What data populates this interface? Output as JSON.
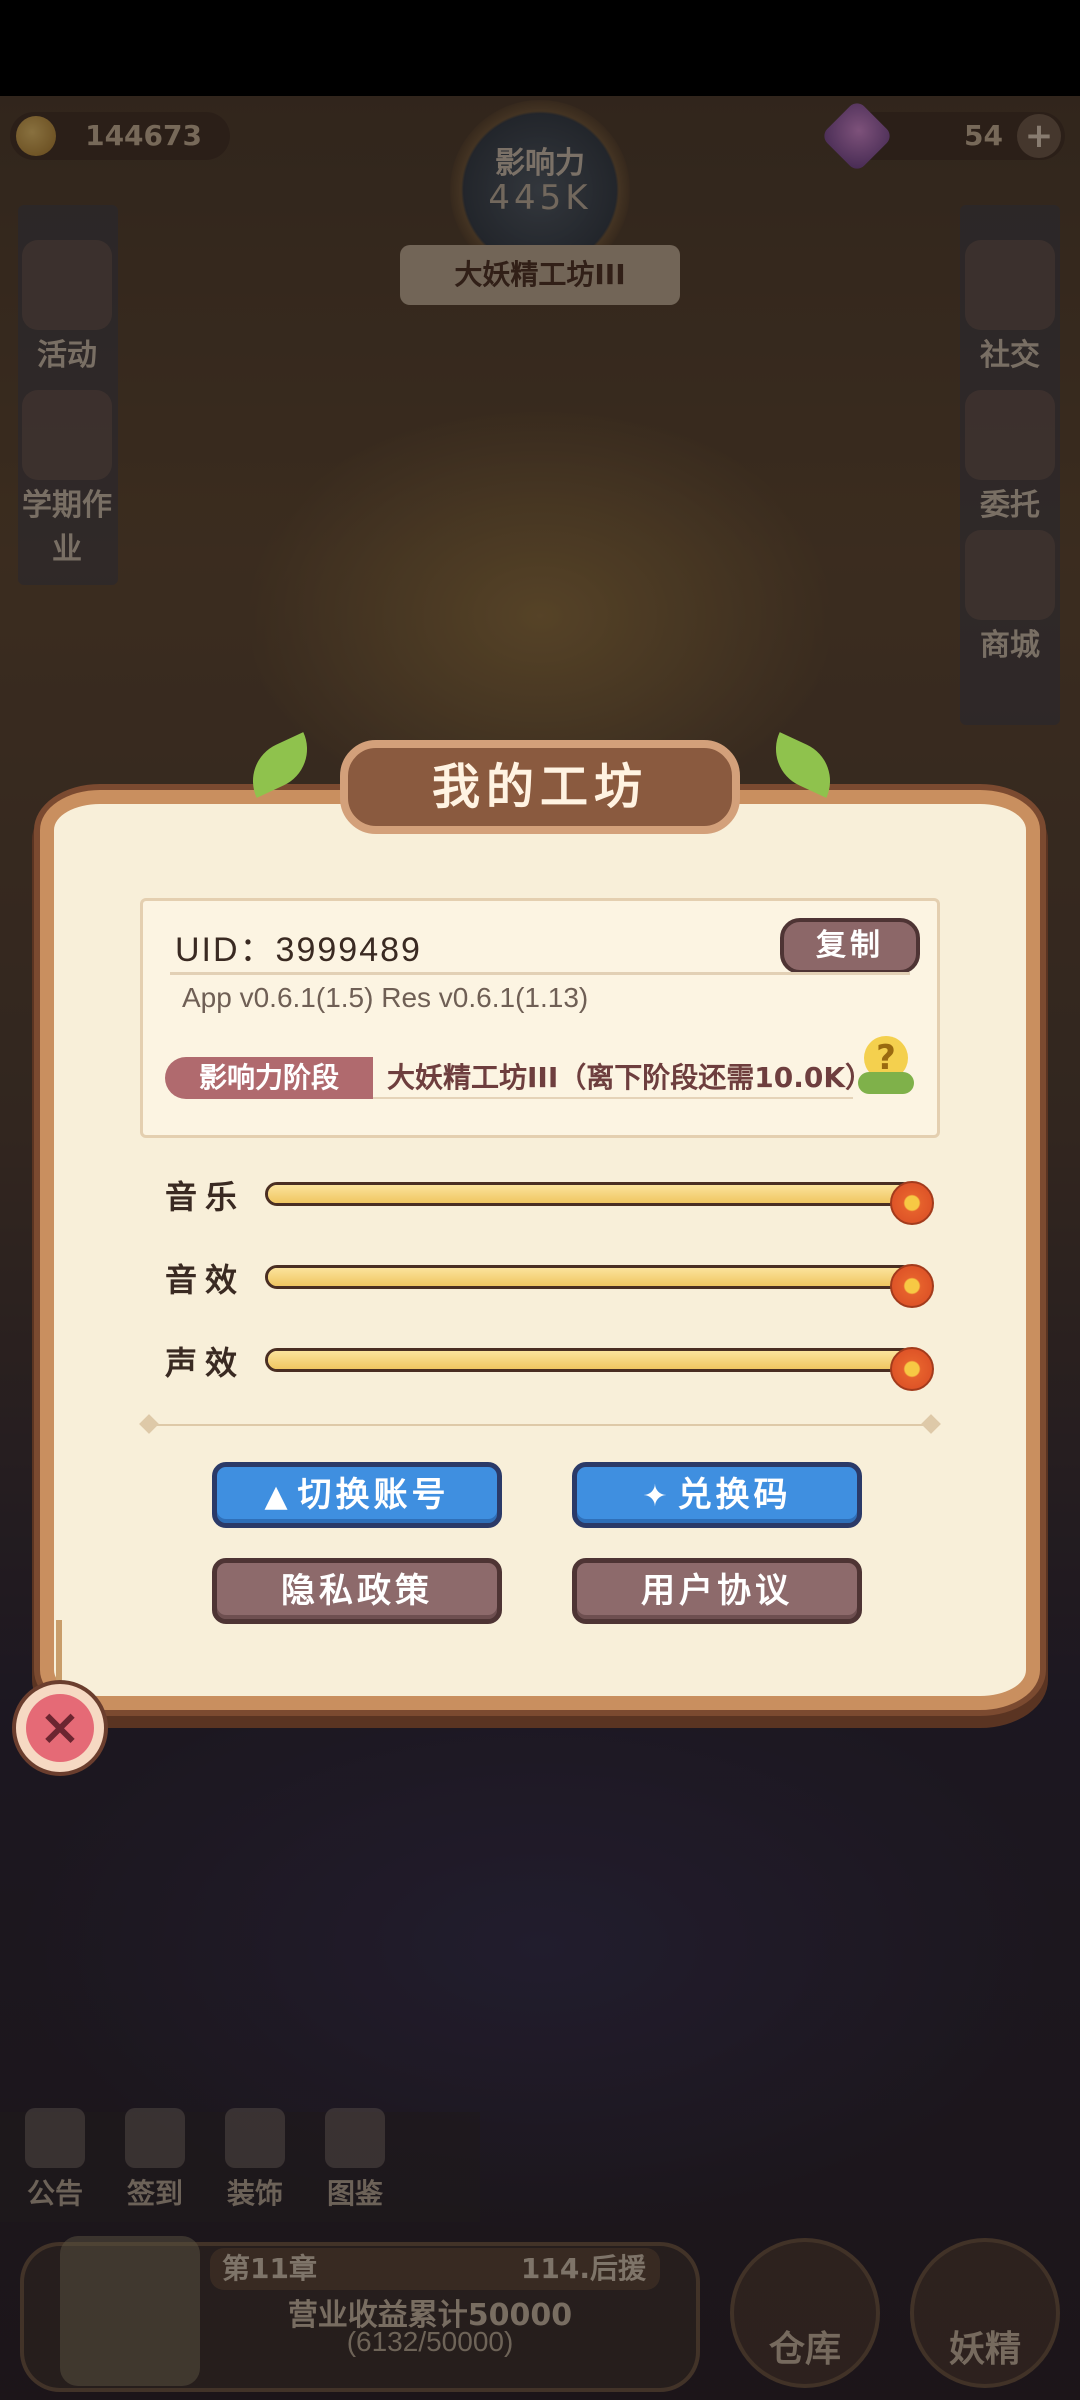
{
  "hud": {
    "coins": "144673",
    "gems": "54",
    "plus": "+",
    "influence_title": "影响力",
    "influence_value": "445K",
    "level_banner": "大妖精工坊III"
  },
  "side_left": [
    {
      "label": "活动"
    },
    {
      "label": "学期作业"
    }
  ],
  "side_right": [
    {
      "label": "社交"
    },
    {
      "label": "委托"
    },
    {
      "label": "商城"
    }
  ],
  "modal": {
    "title": "我的工坊",
    "uid": "UID：3999489",
    "copy_label": "复制",
    "version": "App v0.6.1(1.5)    Res v0.6.1(1.13)",
    "influence_tag": "影响力阶段",
    "influence_stage": "大妖精工坊III（离下阶段还需10.0K）",
    "hint": "?",
    "sliders": [
      {
        "label": "音乐",
        "value": 1.0
      },
      {
        "label": "音效",
        "value": 1.0
      },
      {
        "label": "声效",
        "value": 1.0
      }
    ],
    "buttons": {
      "switch_account": "切换账号",
      "redeem_code": "兑换码",
      "privacy_policy": "隐私政策",
      "user_agreement": "用户协议"
    },
    "close": "×"
  },
  "bottom": {
    "items": [
      {
        "label": "公告"
      },
      {
        "label": "签到"
      },
      {
        "label": "装饰"
      },
      {
        "label": "图鉴"
      }
    ],
    "chapter": "第11章",
    "chapter_next": "114.后援",
    "task": "营业收益累计50000",
    "progress": "(6132/50000)",
    "warehouse": "仓库",
    "fairy": "妖精"
  },
  "colors": {
    "modal_bg": "#f8efd9",
    "button_blue": "#3f8fe0",
    "button_brown": "#8d6a6b",
    "influence_tag": "#b06a6e",
    "slider_fill": "#f0c661"
  }
}
